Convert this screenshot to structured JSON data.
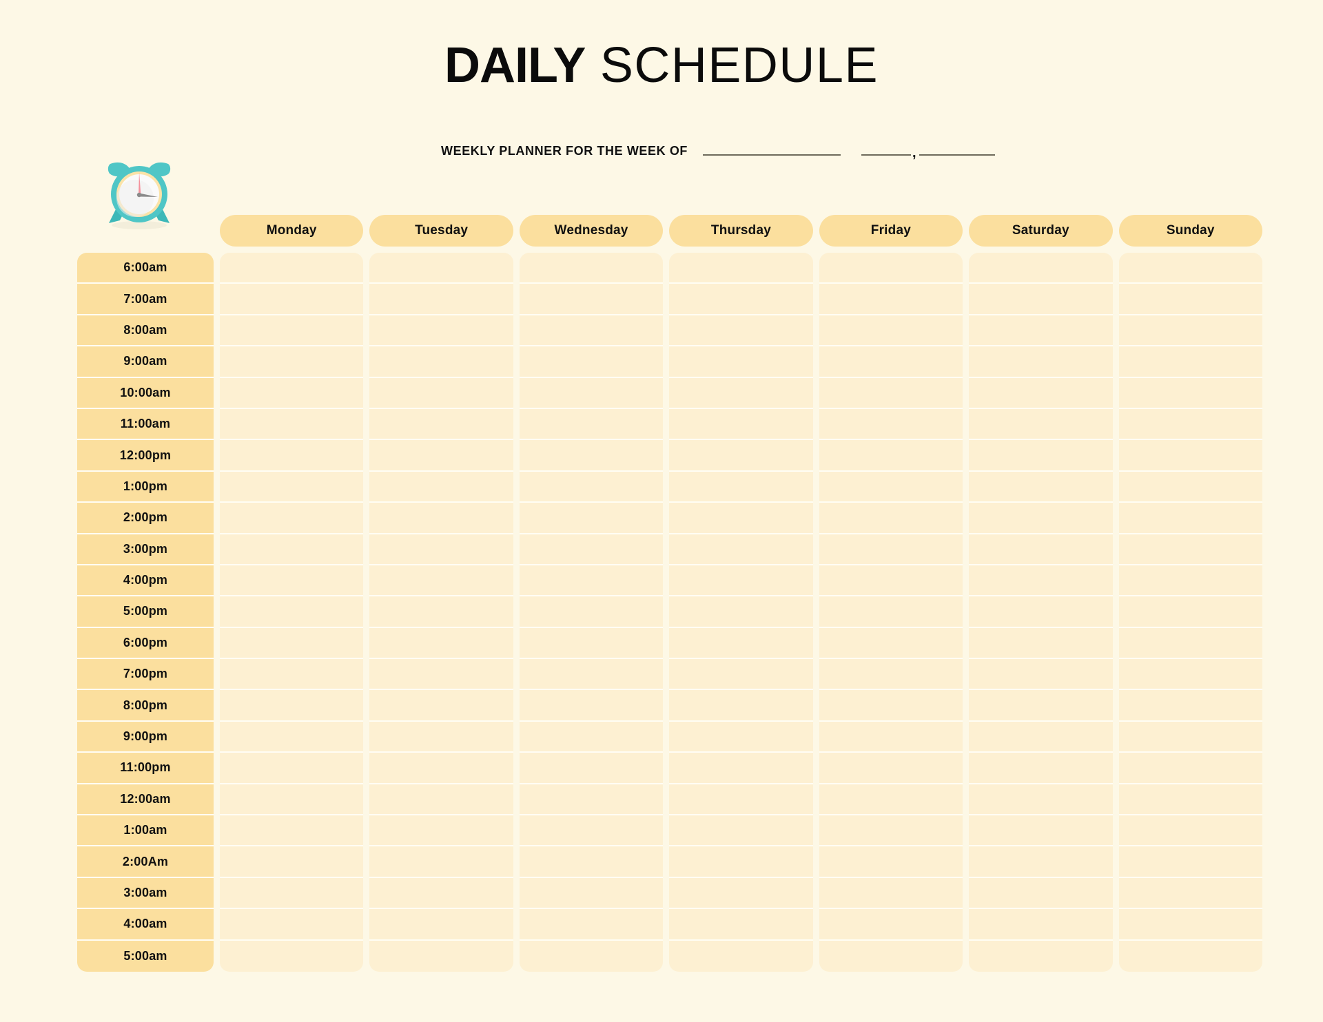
{
  "page": {
    "background_color": "#FDF8E6",
    "title_part_bold": "DAILY",
    "title_part_light": " SCHEDULE"
  },
  "subtitle": {
    "label": "WEEKLY PLANNER FOR THE WEEK OF",
    "comma": ",",
    "blank_fields": [
      "",
      "",
      ""
    ]
  },
  "icons": {
    "alarm_clock": "alarm-clock-icon",
    "alarm_clock_body_color": "#4FC6C6",
    "alarm_clock_ring_color": "#FBE3A8",
    "alarm_clock_minute_hand_color": "#F4909B",
    "alarm_clock_hour_hand_color": "#8A8A8A"
  },
  "grid": {
    "header_pill_color": "#FBDF9E",
    "time_column_color": "#FBDF9E",
    "slot_cell_color": "#FDF0D2",
    "separator_color": "#FFFDF4",
    "days": [
      "Monday",
      "Tuesday",
      "Wednesday",
      "Thursday",
      "Friday",
      "Saturday",
      "Sunday"
    ],
    "times": [
      "6:00am",
      "7:00am",
      "8:00am",
      "9:00am",
      "10:00am",
      "11:00am",
      "12:00pm",
      "1:00pm",
      "2:00pm",
      "3:00pm",
      "4:00pm",
      "5:00pm",
      "6:00pm",
      "7:00pm",
      "8:00pm",
      "9:00pm",
      "11:00pm",
      "12:00am",
      "1:00am",
      "2:00Am",
      "3:00am",
      "4:00am",
      "5:00am"
    ],
    "entries": [
      [
        "",
        "",
        "",
        "",
        "",
        "",
        ""
      ],
      [
        "",
        "",
        "",
        "",
        "",
        "",
        ""
      ],
      [
        "",
        "",
        "",
        "",
        "",
        "",
        ""
      ],
      [
        "",
        "",
        "",
        "",
        "",
        "",
        ""
      ],
      [
        "",
        "",
        "",
        "",
        "",
        "",
        ""
      ],
      [
        "",
        "",
        "",
        "",
        "",
        "",
        ""
      ],
      [
        "",
        "",
        "",
        "",
        "",
        "",
        ""
      ],
      [
        "",
        "",
        "",
        "",
        "",
        "",
        ""
      ],
      [
        "",
        "",
        "",
        "",
        "",
        "",
        ""
      ],
      [
        "",
        "",
        "",
        "",
        "",
        "",
        ""
      ],
      [
        "",
        "",
        "",
        "",
        "",
        "",
        ""
      ],
      [
        "",
        "",
        "",
        "",
        "",
        "",
        ""
      ],
      [
        "",
        "",
        "",
        "",
        "",
        "",
        ""
      ],
      [
        "",
        "",
        "",
        "",
        "",
        "",
        ""
      ],
      [
        "",
        "",
        "",
        "",
        "",
        "",
        ""
      ],
      [
        "",
        "",
        "",
        "",
        "",
        "",
        ""
      ],
      [
        "",
        "",
        "",
        "",
        "",
        "",
        ""
      ],
      [
        "",
        "",
        "",
        "",
        "",
        "",
        ""
      ],
      [
        "",
        "",
        "",
        "",
        "",
        "",
        ""
      ],
      [
        "",
        "",
        "",
        "",
        "",
        "",
        ""
      ],
      [
        "",
        "",
        "",
        "",
        "",
        "",
        ""
      ],
      [
        "",
        "",
        "",
        "",
        "",
        "",
        ""
      ],
      [
        "",
        "",
        "",
        "",
        "",
        "",
        ""
      ]
    ]
  }
}
